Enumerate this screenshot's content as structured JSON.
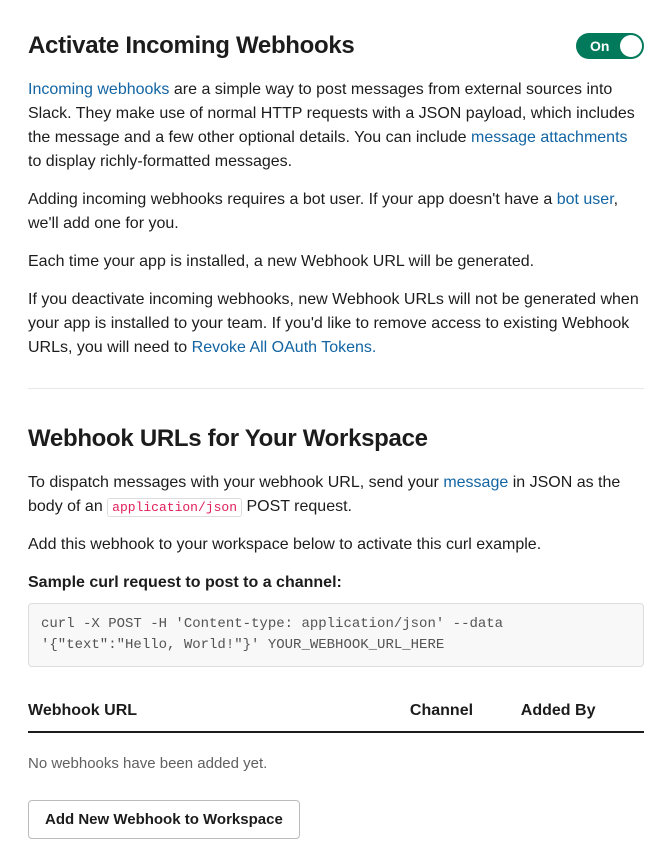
{
  "header": {
    "title": "Activate Incoming Webhooks",
    "toggle_label": "On"
  },
  "intro": {
    "link_incoming": "Incoming webhooks",
    "p1_after_link": " are a simple way to post messages from external sources into Slack. They make use of normal HTTP requests with a JSON payload, which includes the message and a few other optional details. You can include ",
    "link_attachments": "message attachments",
    "p1_tail": " to display richly-formatted messages.",
    "p2_before_link": "Adding incoming webhooks requires a bot user. If your app doesn't have a ",
    "link_bot_user": "bot user",
    "p2_tail": ", we'll add one for you.",
    "p3": "Each time your app is installed, a new Webhook URL will be generated.",
    "p4_before_link": "If you deactivate incoming webhooks, new Webhook URLs will not be generated when your app is installed to your team. If you'd like to remove access to existing Webhook URLs, you will need to ",
    "link_revoke": "Revoke All OAuth Tokens."
  },
  "urls_section": {
    "title": "Webhook URLs for Your Workspace",
    "p1_before_link": "To dispatch messages with your webhook URL, send your ",
    "link_message": "message",
    "p1_mid": " in JSON as the body of an ",
    "code_inline": "application/json",
    "p1_tail": " POST request.",
    "p2": "Add this webhook to your workspace below to activate this curl example.",
    "sample_label": "Sample curl request to post to a channel:",
    "curl_sample": "curl -X POST -H 'Content-type: application/json' --data '{\"text\":\"Hello, World!\"}' YOUR_WEBHOOK_URL_HERE"
  },
  "table": {
    "col_url": "Webhook URL",
    "col_channel": "Channel",
    "col_added_by": "Added By",
    "empty": "No webhooks have been added yet."
  },
  "actions": {
    "add_button": "Add New Webhook to Workspace"
  }
}
